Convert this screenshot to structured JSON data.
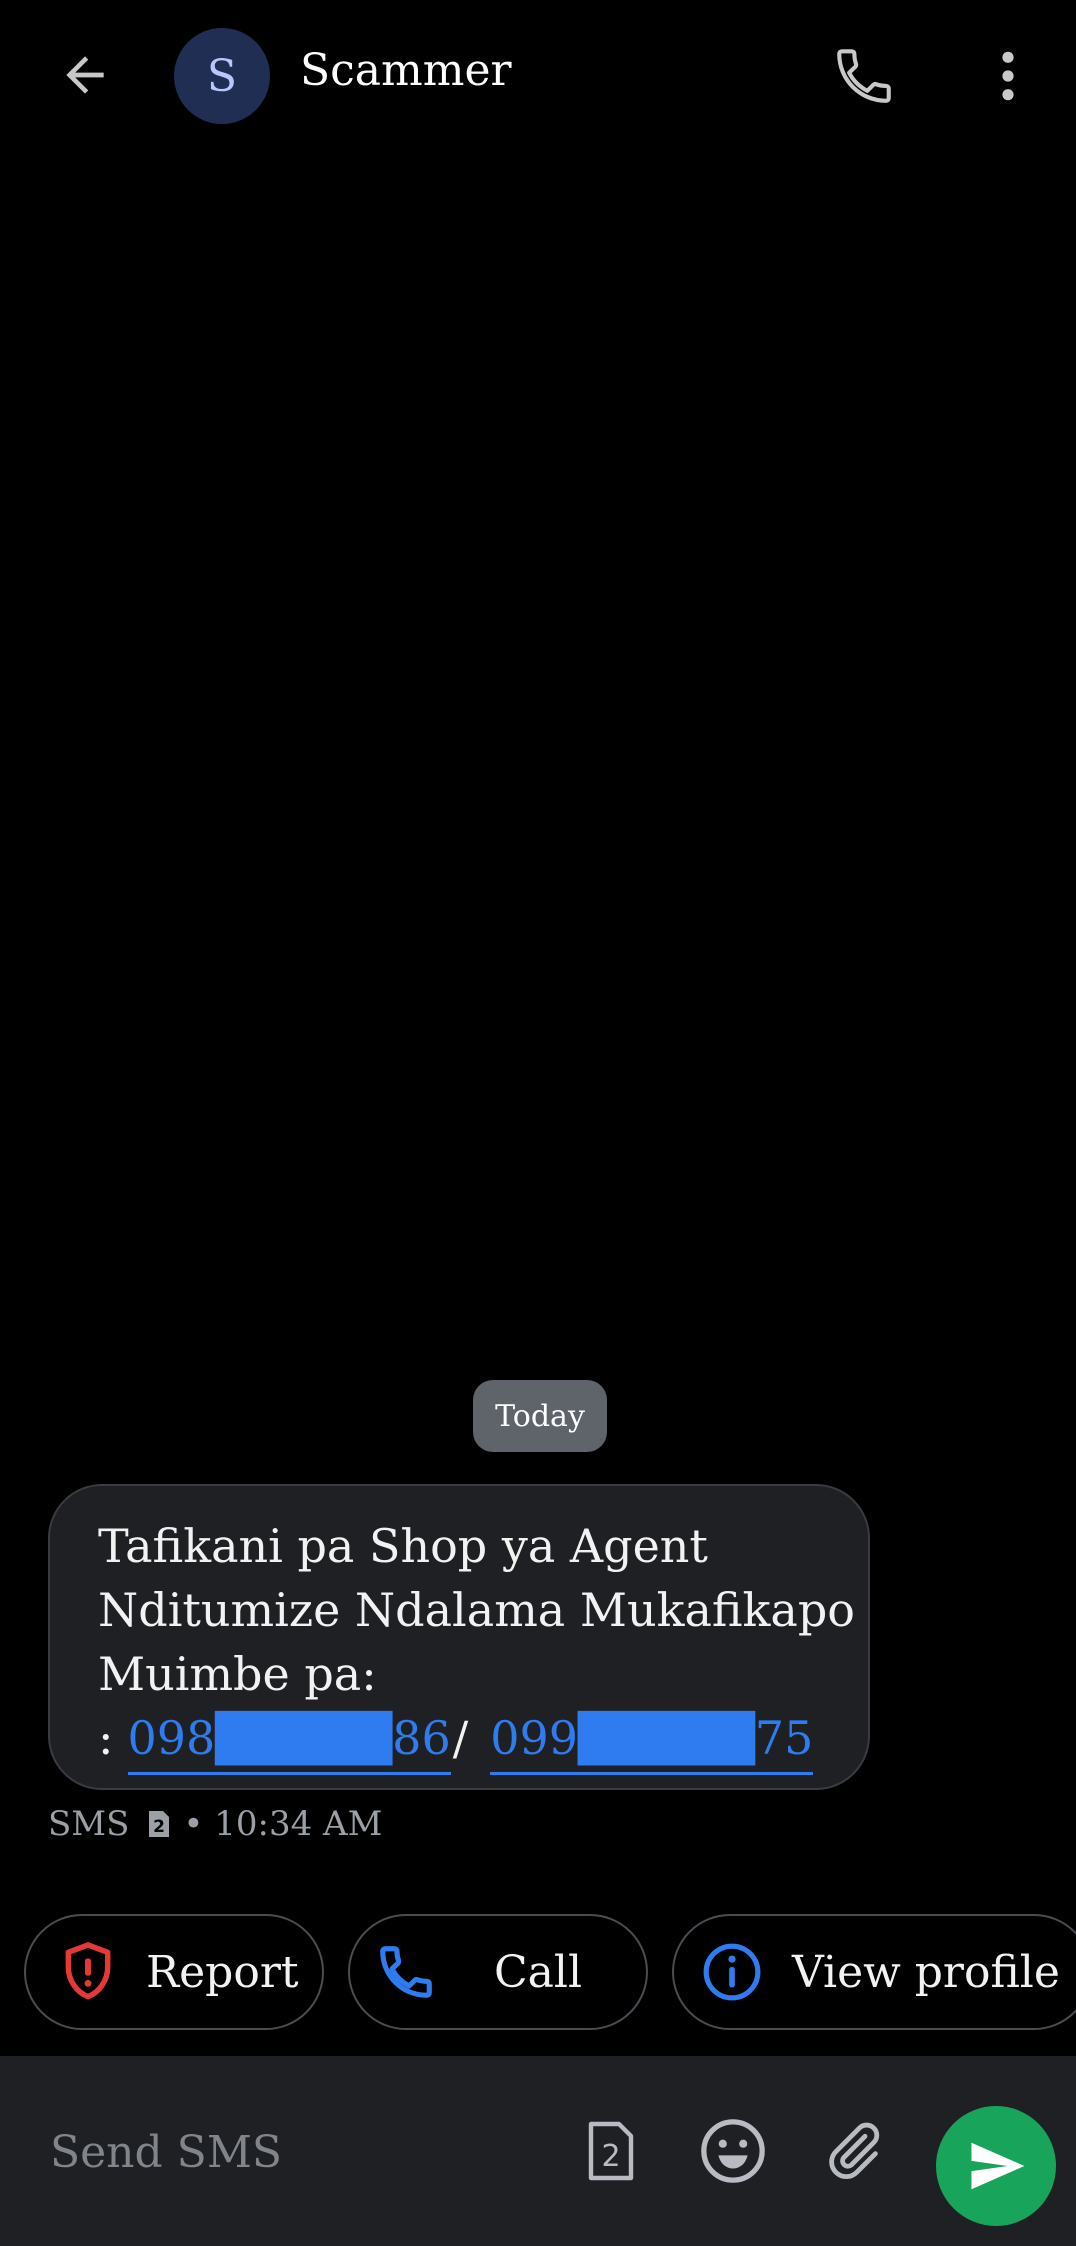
{
  "header": {
    "avatar_letter": "S",
    "contact_name": "Scammer"
  },
  "conversation": {
    "date_label": "Today",
    "message": {
      "lines": [
        "Tafikani pa Shop ya Agent",
        "Nditumize Ndalama Mukafikapo",
        "Muimbe pa:"
      ],
      "phone_prefix": ":",
      "phone_1": "098█████86",
      "phone_separator": "/",
      "phone_2": "099█████75"
    },
    "meta": {
      "type": "SMS",
      "sim": "2",
      "time": "• 10:34 AM"
    }
  },
  "actions": {
    "report_label": "Report",
    "call_label": "Call",
    "view_profile_label": "View profile"
  },
  "composer": {
    "placeholder": "Send SMS",
    "sim_badge": "2"
  },
  "colors": {
    "accent_blue": "#2f7bf0",
    "report_red": "#e53935",
    "send_green": "#19a45b"
  }
}
